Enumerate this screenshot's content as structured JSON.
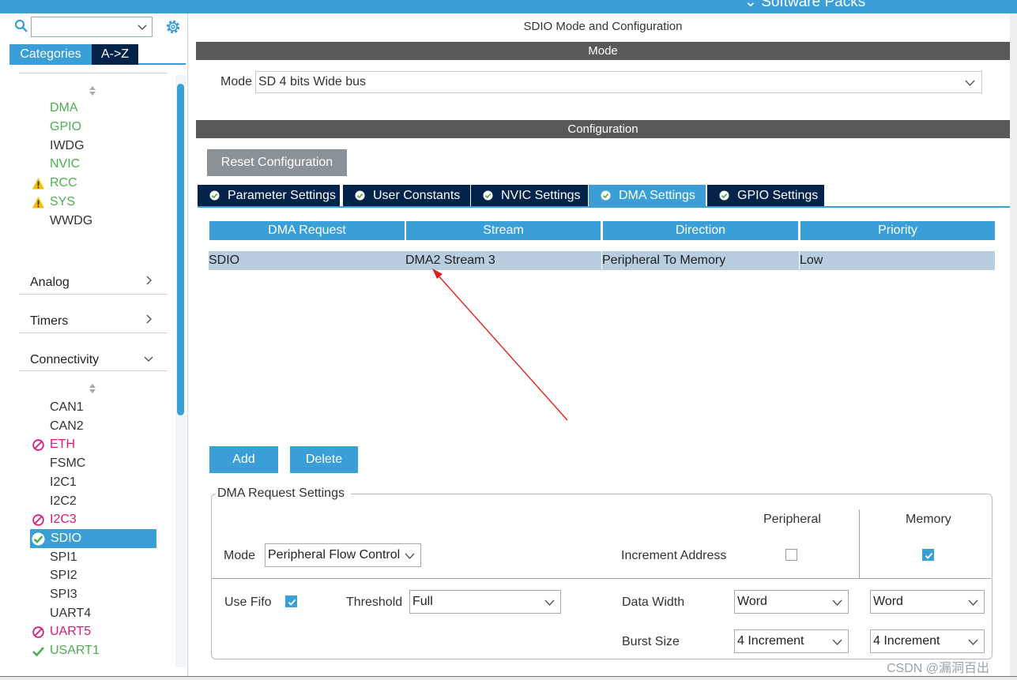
{
  "topbar": {
    "software_packs": "⌄ Software Packs"
  },
  "left": {
    "tabs": {
      "categories": "Categories",
      "az": "A->Z"
    },
    "system_items": [
      {
        "label": "DMA",
        "status": "ok"
      },
      {
        "label": "GPIO",
        "status": "ok"
      },
      {
        "label": "IWDG",
        "status": "none"
      },
      {
        "label": "NVIC",
        "status": "ok"
      },
      {
        "label": "RCC",
        "status": "warning"
      },
      {
        "label": "SYS",
        "status": "warning"
      },
      {
        "label": "WWDG",
        "status": "none"
      }
    ],
    "groups": {
      "analog": "Analog",
      "timers": "Timers",
      "connectivity": "Connectivity"
    },
    "connectivity_items": [
      {
        "label": "CAN1",
        "status": "none"
      },
      {
        "label": "CAN2",
        "status": "none"
      },
      {
        "label": "ETH",
        "status": "disabled"
      },
      {
        "label": "FSMC",
        "status": "none"
      },
      {
        "label": "I2C1",
        "status": "none"
      },
      {
        "label": "I2C2",
        "status": "none"
      },
      {
        "label": "I2C3",
        "status": "disabled"
      },
      {
        "label": "SDIO",
        "status": "selected"
      },
      {
        "label": "SPI1",
        "status": "none"
      },
      {
        "label": "SPI2",
        "status": "none"
      },
      {
        "label": "SPI3",
        "status": "none"
      },
      {
        "label": "UART4",
        "status": "none"
      },
      {
        "label": "UART5",
        "status": "disabled"
      },
      {
        "label": "USART1",
        "status": "ok"
      }
    ]
  },
  "right": {
    "title": "SDIO Mode and Configuration",
    "mode_bar": "Mode",
    "mode_label": "Mode",
    "mode_value": "SD 4 bits Wide bus",
    "config_bar": "Configuration",
    "reset_button": "Reset Configuration",
    "tabs": [
      "Parameter Settings",
      "User Constants",
      "NVIC Settings",
      "DMA Settings",
      "GPIO Settings"
    ],
    "active_tab": "DMA Settings",
    "table": {
      "headers": [
        "DMA Request",
        "Stream",
        "Direction",
        "Priority"
      ],
      "rows": [
        [
          "SDIO",
          "DMA2 Stream 3",
          "Peripheral To Memory",
          "Low"
        ]
      ]
    },
    "add_button": "Add",
    "delete_button": "Delete",
    "settings": {
      "legend": "DMA Request Settings",
      "peripheral_header": "Peripheral",
      "memory_header": "Memory",
      "mode_label": "Mode",
      "mode_value": "Peripheral Flow Control",
      "increment_label": "Increment Address",
      "peripheral_increment": false,
      "memory_increment": true,
      "use_fifo_label": "Use Fifo",
      "use_fifo": true,
      "threshold_label": "Threshold",
      "threshold_value": "Full",
      "data_width_label": "Data Width",
      "peripheral_width": "Word",
      "memory_width": "Word",
      "burst_label": "Burst Size",
      "peripheral_burst": "4 Increment",
      "memory_burst": "4 Increment"
    }
  },
  "watermark": "CSDN @漏洞百出",
  "colors": {
    "accent": "#3a9fd6",
    "navy": "#03234b",
    "green": "#4caf50",
    "pink": "#d81b78",
    "warning": "#f5c000",
    "annotation": "#e02020"
  }
}
